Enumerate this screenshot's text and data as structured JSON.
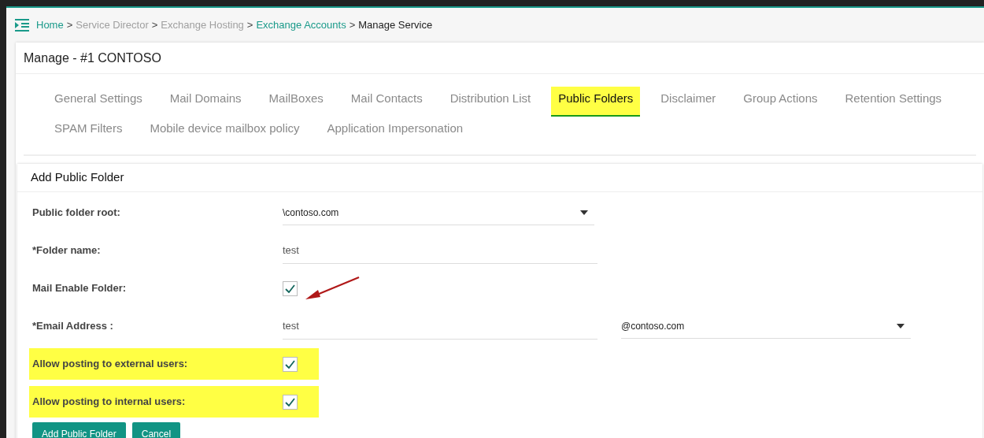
{
  "breadcrumb": [
    {
      "label": "Home",
      "kind": "link"
    },
    {
      "label": "Service Director",
      "kind": "muted"
    },
    {
      "label": "Exchange Hosting",
      "kind": "muted"
    },
    {
      "label": "Exchange Accounts",
      "kind": "link"
    },
    {
      "label": "Manage Service",
      "kind": "current"
    }
  ],
  "breadcrumb_separator": ">",
  "page_title": "Manage - #1 CONTOSO",
  "tabs": [
    [
      {
        "label": "General Settings",
        "selected": false,
        "highlighted": false
      },
      {
        "label": "Mail Domains",
        "selected": false,
        "highlighted": false
      },
      {
        "label": "MailBoxes",
        "selected": false,
        "highlighted": false
      },
      {
        "label": "Mail Contacts",
        "selected": false,
        "highlighted": false
      },
      {
        "label": "Distribution List",
        "selected": false,
        "highlighted": false
      },
      {
        "label": "Public Folders",
        "selected": true,
        "highlighted": true
      },
      {
        "label": "Disclaimer",
        "selected": false,
        "highlighted": false
      },
      {
        "label": "Group Actions",
        "selected": false,
        "highlighted": false
      },
      {
        "label": "Retention Settings",
        "selected": false,
        "highlighted": false
      }
    ],
    [
      {
        "label": "SPAM Filters",
        "selected": false,
        "highlighted": false
      },
      {
        "label": "Mobile device mailbox policy",
        "selected": false,
        "highlighted": false
      },
      {
        "label": "Application Impersonation",
        "selected": false,
        "highlighted": false
      }
    ]
  ],
  "form": {
    "title": "Add Public Folder",
    "rows": [
      {
        "kind": "select",
        "label": "Public folder root:",
        "value": "\\contoso.com",
        "highlighted": false
      },
      {
        "kind": "text",
        "label": "*Folder name:",
        "value": "test",
        "highlighted": false
      },
      {
        "kind": "checkbox",
        "label": "Mail Enable Folder:",
        "checked": true,
        "highlighted": false,
        "arrow": true
      },
      {
        "kind": "email",
        "label": "*Email Address :",
        "value": "test",
        "domain": "@contoso.com",
        "highlighted": false
      },
      {
        "kind": "checkbox",
        "label": "Allow posting to external users:",
        "checked": true,
        "highlighted": true,
        "arrow": false
      },
      {
        "kind": "checkbox",
        "label": "Allow posting to internal users:",
        "checked": true,
        "highlighted": true,
        "arrow": false
      }
    ],
    "buttons": [
      "Add Public Folder",
      "Cancel"
    ]
  }
}
